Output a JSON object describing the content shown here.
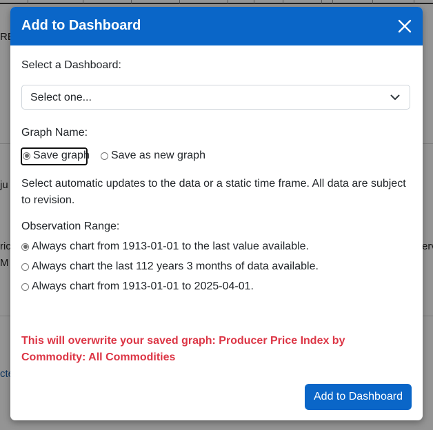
{
  "background": {
    "fragments": [
      "RE",
      "ju",
      "ric",
      "M",
      "erv",
      "cte"
    ]
  },
  "modal": {
    "title": "Add to Dashboard",
    "close_icon": "close-icon",
    "dashboard": {
      "label": "Select a Dashboard:",
      "selected_value": "Select one..."
    },
    "graph_name": {
      "label": "Graph Name:",
      "options": [
        "Save graph",
        "Save as new graph"
      ],
      "selected": "Save graph"
    },
    "description": "Select automatic updates to the data or a static time frame. All data are subject to revision.",
    "observation_range": {
      "label": "Observation Range:",
      "options": [
        "Always chart from 1913-01-01 to the last value available.",
        "Always chart the last 112 years 3 months of data available.",
        "Always chart from 1913-01-01 to 2025-04-01."
      ],
      "selected": "Always chart from 1913-01-01 to the last value available."
    },
    "warning": "This will overwrite your saved graph: Producer Price Index by Commodity: All Commodities",
    "submit_label": "Add to Dashboard"
  },
  "colors": {
    "header": "#0a66c8",
    "primary_button": "#0a66c8",
    "warning": "#dc3545"
  }
}
